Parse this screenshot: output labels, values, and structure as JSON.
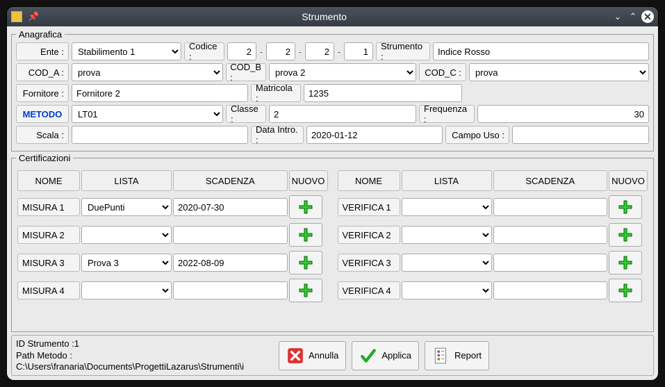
{
  "window": {
    "title": "Strumento"
  },
  "fieldsets": {
    "ana": "Anagrafica",
    "cert": "Certificazioni"
  },
  "labels": {
    "ente": "Ente :",
    "codice": "Codice :",
    "strumento": "Strumento :",
    "coda": "COD_A :",
    "codb": "COD_B :",
    "codc": "COD_C :",
    "fornitore": "Fornitore :",
    "matricola": "Matricola :",
    "metodo": "METODO",
    "classe": "Classe :",
    "frequenza": "Frequenza :",
    "scala": "Scala :",
    "dataintro": "Data Intro. :",
    "campouso": "Campo Uso :"
  },
  "values": {
    "ente": "Stabilimento 1",
    "codice": [
      "2",
      "2",
      "2",
      "1"
    ],
    "strumento": "Indice Rosso",
    "coda": "prova",
    "codb": "prova 2",
    "codc": "prova",
    "fornitore": "Fornitore 2",
    "matricola": "1235",
    "metodo": "LT01",
    "classe": "2",
    "frequenza": "30",
    "scala": "",
    "dataintro": "2020-01-12",
    "campouso": ""
  },
  "cert_headers": {
    "nome": "NOME",
    "lista": "LISTA",
    "scad": "SCADENZA",
    "nuovo": "NUOVO"
  },
  "cert_left": [
    {
      "nome": "MISURA 1",
      "lista": "DuePunti",
      "scad": "2020-07-30"
    },
    {
      "nome": "MISURA 2",
      "lista": "",
      "scad": ""
    },
    {
      "nome": "MISURA 3",
      "lista": "Prova 3",
      "scad": "2022-08-09"
    },
    {
      "nome": "MISURA 4",
      "lista": "",
      "scad": ""
    }
  ],
  "cert_right": [
    {
      "nome": "VERIFICA 1",
      "lista": "",
      "scad": ""
    },
    {
      "nome": "VERIFICA 2",
      "lista": "",
      "scad": ""
    },
    {
      "nome": "VERIFICA 3",
      "lista": "",
      "scad": ""
    },
    {
      "nome": "VERIFICA 4",
      "lista": "",
      "scad": ""
    }
  ],
  "footer": {
    "id": "ID Strumento :1",
    "path_label": "Path Metodo :",
    "path": "C:\\Users\\franaria\\Documents\\ProgettiLazarus\\Strumenti\\i",
    "annulla": "Annulla",
    "applica": "Applica",
    "report": "Report"
  }
}
